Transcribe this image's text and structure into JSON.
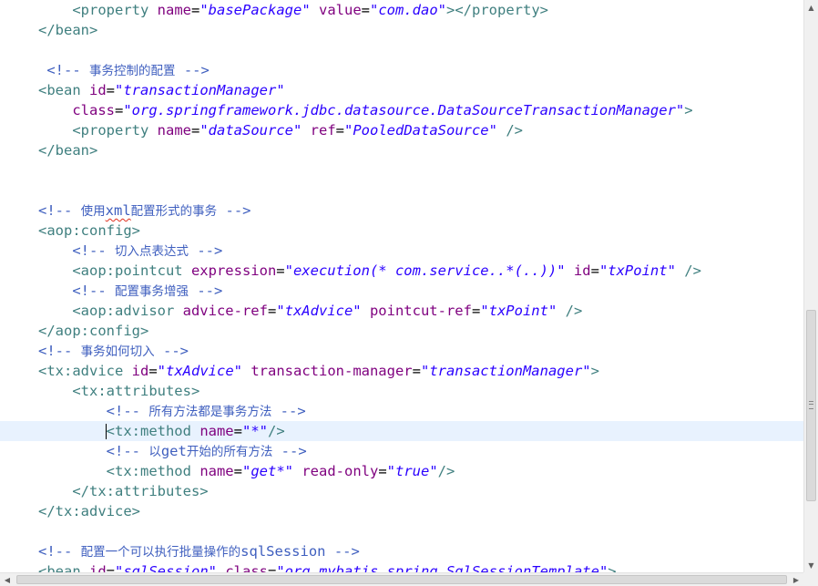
{
  "editor": {
    "lines": [
      [
        {
          "c": "tag",
          "t": "    <property"
        },
        {
          "c": "attr",
          "t": " name"
        },
        {
          "c": "punct",
          "t": "="
        },
        {
          "c": "val",
          "t": "\"basePackage\""
        },
        {
          "c": "attr",
          "t": " value"
        },
        {
          "c": "punct",
          "t": "="
        },
        {
          "c": "val",
          "t": "\"com.dao\""
        },
        {
          "c": "tag",
          "t": "></property>"
        }
      ],
      [
        {
          "c": "tag",
          "t": "</bean>"
        }
      ],
      [],
      [
        {
          "c": "comment",
          "t": " <!-- "
        },
        {
          "c": "cjk",
          "t": "事务控制的配置"
        },
        {
          "c": "comment",
          "t": " -->"
        }
      ],
      [
        {
          "c": "tag",
          "t": "<bean"
        },
        {
          "c": "attr",
          "t": " id"
        },
        {
          "c": "punct",
          "t": "="
        },
        {
          "c": "val",
          "t": "\"transactionManager\""
        }
      ],
      [
        {
          "c": "attr",
          "t": "    class"
        },
        {
          "c": "punct",
          "t": "="
        },
        {
          "c": "val",
          "t": "\"org.springframework.jdbc.datasource.DataSourceTransactionManager\""
        },
        {
          "c": "tag",
          "t": ">"
        }
      ],
      [
        {
          "c": "tag",
          "t": "    <property"
        },
        {
          "c": "attr",
          "t": " name"
        },
        {
          "c": "punct",
          "t": "="
        },
        {
          "c": "val",
          "t": "\"dataSource\""
        },
        {
          "c": "attr",
          "t": " ref"
        },
        {
          "c": "punct",
          "t": "="
        },
        {
          "c": "val",
          "t": "\"PooledDataSource\""
        },
        {
          "c": "tag",
          "t": " />"
        }
      ],
      [
        {
          "c": "tag",
          "t": "</bean>"
        }
      ],
      [],
      [],
      [
        {
          "c": "comment",
          "t": "<!-- "
        },
        {
          "c": "cjk",
          "t": "使用"
        },
        {
          "c": "squiggle",
          "t": "xml"
        },
        {
          "c": "cjk",
          "t": "配置形式的事务"
        },
        {
          "c": "comment",
          "t": " -->"
        }
      ],
      [
        {
          "c": "tag",
          "t": "<aop:config>"
        }
      ],
      [
        {
          "c": "comment",
          "t": "    <!-- "
        },
        {
          "c": "cjk",
          "t": "切入点表达式"
        },
        {
          "c": "comment",
          "t": " -->"
        }
      ],
      [
        {
          "c": "tag",
          "t": "    <aop:pointcut"
        },
        {
          "c": "attr",
          "t": " expression"
        },
        {
          "c": "punct",
          "t": "="
        },
        {
          "c": "val",
          "t": "\"execution(* com.service..*(..))\""
        },
        {
          "c": "attr",
          "t": " id"
        },
        {
          "c": "punct",
          "t": "="
        },
        {
          "c": "val",
          "t": "\"txPoint\""
        },
        {
          "c": "tag",
          "t": " />"
        }
      ],
      [
        {
          "c": "comment",
          "t": "    <!-- "
        },
        {
          "c": "cjk",
          "t": "配置事务增强"
        },
        {
          "c": "comment",
          "t": " -->"
        }
      ],
      [
        {
          "c": "tag",
          "t": "    <aop:advisor"
        },
        {
          "c": "attr",
          "t": " advice-ref"
        },
        {
          "c": "punct",
          "t": "="
        },
        {
          "c": "val",
          "t": "\"txAdvice\""
        },
        {
          "c": "attr",
          "t": " pointcut-ref"
        },
        {
          "c": "punct",
          "t": "="
        },
        {
          "c": "val",
          "t": "\"txPoint\""
        },
        {
          "c": "tag",
          "t": " />"
        }
      ],
      [
        {
          "c": "tag",
          "t": "</aop:config>"
        }
      ],
      [
        {
          "c": "comment",
          "t": "<!-- "
        },
        {
          "c": "cjk",
          "t": "事务如何切入"
        },
        {
          "c": "comment",
          "t": " -->"
        }
      ],
      [
        {
          "c": "tag",
          "t": "<tx:advice"
        },
        {
          "c": "attr",
          "t": " id"
        },
        {
          "c": "punct",
          "t": "="
        },
        {
          "c": "val",
          "t": "\"txAdvice\""
        },
        {
          "c": "attr",
          "t": " transaction-manager"
        },
        {
          "c": "punct",
          "t": "="
        },
        {
          "c": "val",
          "t": "\"transactionManager\""
        },
        {
          "c": "tag",
          "t": ">"
        }
      ],
      [
        {
          "c": "tag",
          "t": "    <tx:attributes>"
        }
      ],
      [
        {
          "c": "comment",
          "t": "        <!-- "
        },
        {
          "c": "cjk",
          "t": "所有方法都是事务方法"
        },
        {
          "c": "comment",
          "t": " -->"
        }
      ],
      [
        {
          "c": "tag",
          "t": "        "
        },
        {
          "c": "caret",
          "t": ""
        },
        {
          "c": "tag",
          "t": "<tx:method"
        },
        {
          "c": "attr",
          "t": " name"
        },
        {
          "c": "punct",
          "t": "="
        },
        {
          "c": "val",
          "t": "\"*\""
        },
        {
          "c": "tag",
          "t": "/>"
        }
      ],
      [
        {
          "c": "comment",
          "t": "        <!-- "
        },
        {
          "c": "cjk",
          "t": "以"
        },
        {
          "c": "comment",
          "t": "get"
        },
        {
          "c": "cjk",
          "t": "开始的所有方法"
        },
        {
          "c": "comment",
          "t": " -->"
        }
      ],
      [
        {
          "c": "tag",
          "t": "        <tx:method"
        },
        {
          "c": "attr",
          "t": " name"
        },
        {
          "c": "punct",
          "t": "="
        },
        {
          "c": "val",
          "t": "\"get*\""
        },
        {
          "c": "attr",
          "t": " read-only"
        },
        {
          "c": "punct",
          "t": "="
        },
        {
          "c": "val",
          "t": "\"true\""
        },
        {
          "c": "tag",
          "t": "/>"
        }
      ],
      [
        {
          "c": "tag",
          "t": "    </tx:attributes>"
        }
      ],
      [
        {
          "c": "tag",
          "t": "</tx:advice>"
        }
      ],
      [],
      [
        {
          "c": "comment",
          "t": "<!-- "
        },
        {
          "c": "cjk",
          "t": "配置一个可以执行批量操作的"
        },
        {
          "c": "comment",
          "t": "sqlSession -->"
        }
      ],
      [
        {
          "c": "tag",
          "t": "<bean"
        },
        {
          "c": "attr",
          "t": " id"
        },
        {
          "c": "punct",
          "t": "="
        },
        {
          "c": "val",
          "t": "\"sqlSession\""
        },
        {
          "c": "attr",
          "t": " class"
        },
        {
          "c": "punct",
          "t": "="
        },
        {
          "c": "val",
          "t": "\"org.mybatis.spring.SqlSessionTemplate\""
        },
        {
          "c": "tag",
          "t": ">"
        }
      ]
    ],
    "current_line": 21
  },
  "colors": {
    "tag": "#3f7f7f",
    "attr": "#7f007f",
    "value": "#2a00ff",
    "comment": "#3f5fbf",
    "current_line_bg": "#e8f2fe"
  },
  "icons": {
    "scroll_up": "triangle-up-icon",
    "scroll_down": "triangle-down-icon",
    "scroll_left": "triangle-left-icon",
    "scroll_right": "triangle-right-icon",
    "grip": "grip-icon"
  }
}
